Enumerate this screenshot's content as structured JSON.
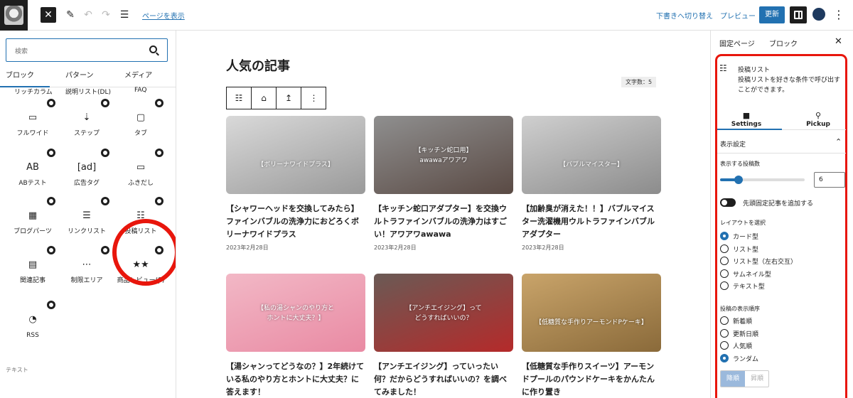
{
  "topbar": {
    "view_page": "ページを表示",
    "switch_to_draft": "下書きへ切り替え",
    "preview": "プレビュー",
    "update": "更新",
    "close_icon": "✕",
    "pen_icon": "✎",
    "undo_icon": "↶",
    "redo_icon": "↷",
    "list_icon": "☰",
    "more_icon": "⋮"
  },
  "inserter": {
    "search_placeholder": "検索",
    "tabs": [
      "ブロック",
      "パターン",
      "メディア"
    ],
    "cut_labels": [
      "リッチカラム",
      "説明リスト(DL)",
      "FAQ"
    ],
    "blocks": [
      {
        "label": "フルワイド",
        "icon": "▭"
      },
      {
        "label": "ステップ",
        "icon": "⇣"
      },
      {
        "label": "タブ",
        "icon": "▢"
      },
      {
        "label": "ABテスト",
        "icon": "AB"
      },
      {
        "label": "広告タグ",
        "icon": "[ad]"
      },
      {
        "label": "ふきだし",
        "icon": "▭"
      },
      {
        "label": "ブログパーツ",
        "icon": "▦"
      },
      {
        "label": "リンクリスト",
        "icon": "☰"
      },
      {
        "label": "投稿リスト",
        "icon": "☷"
      },
      {
        "label": "関連記事",
        "icon": "▤"
      },
      {
        "label": "制限エリア",
        "icon": "⋯"
      },
      {
        "label": "商品レビュー(β)",
        "icon": "★★"
      },
      {
        "label": "RSS",
        "icon": "◔"
      }
    ],
    "text_section": "テキスト"
  },
  "editor": {
    "heading": "人気の記事",
    "word_count": "文字数：5",
    "toolbar_icons": [
      "☷",
      "⌂",
      "↥",
      "⋮"
    ],
    "cards": [
      {
        "title": "【シャワーヘッドを交換してみたら】ファインバブルの洗浄力におどろくボリーナワイドプラス",
        "date": "2023年2月28日",
        "caption": "【ボリーナワイドプラス】",
        "color_top": "#d9d9d9",
        "color_bottom": "#9a9a9a"
      },
      {
        "title": "【キッチン蛇口アダプター】を交換ウルトラファインバブルの洗浄力はすごい！アワアワawawa",
        "date": "2023年2月28日",
        "caption": "【キッチン蛇口用】\nawawaアワアワ",
        "color_top": "#8f8f8f",
        "color_bottom": "#5a4a44"
      },
      {
        "title": "【加齢臭が消えた！！】バブルマイスター洗濯機用ウルトラファインバブルアダプター",
        "date": "2023年2月28日",
        "caption": "【バブルマイスター】",
        "color_top": "#cfcfcf",
        "color_bottom": "#8c8c8c"
      },
      {
        "title": "【湯シャンってどうなの？】2年続けている私のやり方とホントに大丈夫？に答えます！",
        "date": "",
        "caption": "【私の湯シャンのやり方と\nホントに大丈夫？】",
        "color_top": "#f2b8c6",
        "color_bottom": "#e98aa3"
      },
      {
        "title": "【アンチエイジング】っていったい何？だからどうすればいいの？を調べてみました！",
        "date": "",
        "caption": "【アンチエイジング】って\nどうすればいいの？",
        "color_top": "#6a5a55",
        "color_bottom": "#b52a2a"
      },
      {
        "title": "【低糖質な手作りスイーツ】アーモンドプールのパウンドケーキをかんたんに作り置き",
        "date": "",
        "caption": "【低糖質な手作りアーモンドPケーキ】",
        "color_top": "#c9a46a",
        "color_bottom": "#8a6a3a"
      }
    ]
  },
  "panel": {
    "tabs": [
      "固定ページ",
      "ブロック"
    ],
    "close_icon": "✕",
    "block_name": "投稿リスト",
    "block_desc": "投稿リストを好きな条件で呼び出すことができます。",
    "subtabs": [
      {
        "label": "Settings",
        "icon": "■"
      },
      {
        "label": "Pickup",
        "icon": "📍"
      }
    ],
    "display_settings": "表示設定",
    "count_label": "表示する投稿数",
    "count_value": "6",
    "count_fraction": 0.22,
    "sticky_label": "先頭固定記事を追加する",
    "layout_label": "レイアウトを選択",
    "layouts": [
      "カード型",
      "リスト型",
      "リスト型（左右交互）",
      "サムネイル型",
      "テキスト型"
    ],
    "layout_selected": 0,
    "order_label": "投稿の表示順序",
    "orders": [
      "新着順",
      "更新日順",
      "人気順",
      "ランダム"
    ],
    "order_selected": 3,
    "sort_desc": "降順",
    "sort_asc": "昇順"
  },
  "colors": {
    "accent": "#2271b1",
    "highlight_ring": "#e8160c"
  }
}
